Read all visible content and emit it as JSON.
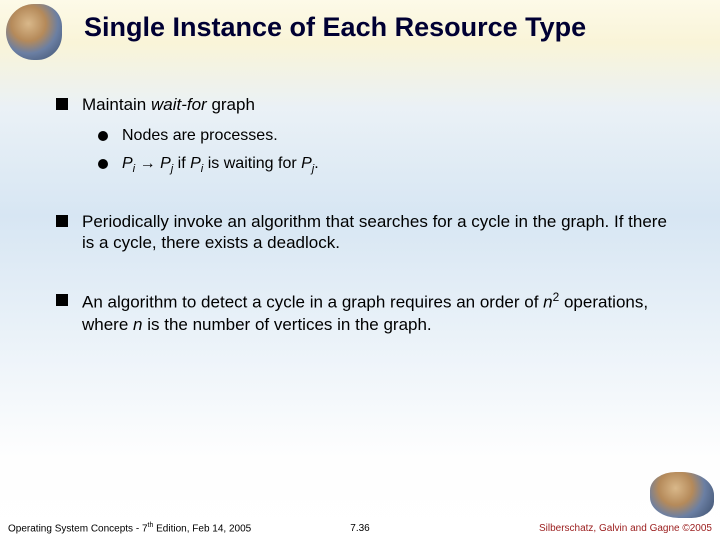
{
  "title": "Single Instance of Each Resource Type",
  "bullets": {
    "b1": {
      "pre": "Maintain ",
      "em": "wait-for",
      "post": " graph"
    },
    "b1a": "Nodes are processes.",
    "b1b": {
      "pi": "P",
      "i": "i",
      "arrow": " → ",
      "pj": "P",
      "j": "j",
      "mid": "  if ",
      "pi2": "P",
      "i2": "i",
      "mid2": " is waiting for ",
      "pj2": "P",
      "j2": "j",
      "end": "."
    },
    "b2": "Periodically invoke an algorithm that searches for a cycle in the graph. If there is a cycle, there exists a deadlock.",
    "b3": {
      "pre": "An algorithm to detect a cycle in a graph requires an order of ",
      "n": "n",
      "sup": "2",
      "mid": " operations, where ",
      "n2": "n",
      "post": " is the number of vertices in the graph."
    }
  },
  "footer": {
    "left_pre": "Operating System Concepts - 7",
    "left_sup": "th",
    "left_post": " Edition, Feb 14, 2005",
    "center": "7.36",
    "right_pre": "Silberschatz, Galvin and Gagne ",
    "right_copy": "©",
    "right_year": "2005"
  }
}
